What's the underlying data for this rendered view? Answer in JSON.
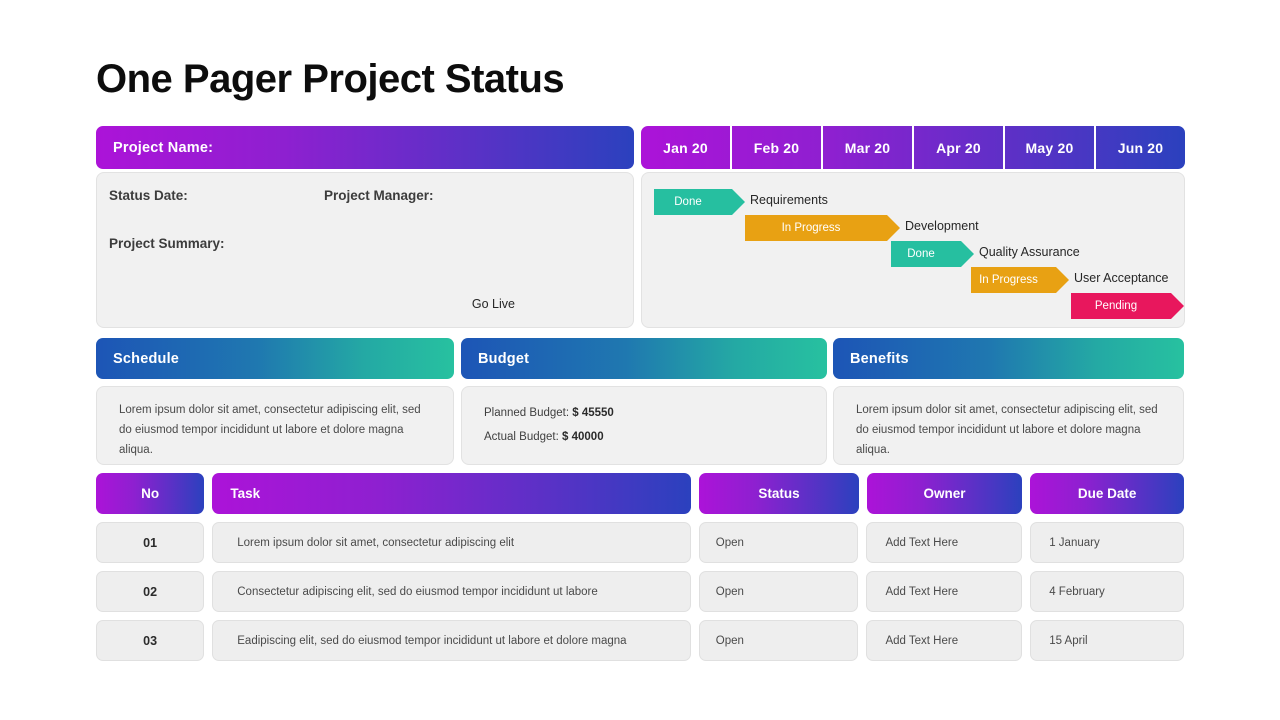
{
  "page_title": "One Pager Project Status",
  "project_name_label": "Project Name:",
  "timeline": {
    "months": [
      "Jan 20",
      "Feb 20",
      "Mar 20",
      "Apr  20",
      "May 20",
      "Jun 20"
    ]
  },
  "info": {
    "status_date_label": "Status Date:",
    "project_manager_label": "Project Manager:",
    "project_summary_label": "Project Summary:"
  },
  "gantt": {
    "colors": {
      "done": "#26bfa0",
      "in_progress": "#e8a113",
      "pending": "#e8175d"
    },
    "rows": [
      {
        "status": "Done",
        "phase": "Requirements",
        "label_side": "right"
      },
      {
        "status": "In Progress",
        "phase": "Development",
        "label_side": "right"
      },
      {
        "status": "Done",
        "phase": "Quality Assurance",
        "label_side": "right"
      },
      {
        "status": "In Progress",
        "phase": "User Acceptance",
        "label_side": "right"
      },
      {
        "status": "Pending",
        "phase": "Go Live",
        "label_side": "left"
      }
    ]
  },
  "sections": [
    {
      "title": "Schedule",
      "body": "Lorem ipsum dolor  sit amet, consectetur adipiscing elit, sed do eiusmod tempor incididunt ut labore et dolore magna aliqua."
    },
    {
      "title": "Budget",
      "planned_label": "Planned Budget:",
      "planned_value": "$ 45550",
      "actual_label": "Actual Budget:",
      "actual_value": "$ 40000"
    },
    {
      "title": "Benefits",
      "body": "Lorem ipsum dolor sit amet, consectetur adipiscing elit, sed do eiusmod tempor incididunt ut labore et dolore magna aliqua."
    }
  ],
  "table": {
    "headers": [
      "No",
      "Task",
      "Status",
      "Owner",
      "Due Date"
    ],
    "rows": [
      {
        "no": "01",
        "task": "Lorem ipsum dolor  sit amet, consectetur adipiscing elit",
        "status": "Open",
        "owner": "Add Text Here",
        "due": "1 January"
      },
      {
        "no": "02",
        "task": "Consectetur adipiscing elit, sed do eiusmod tempor incididunt ut labore",
        "status": "Open",
        "owner": "Add Text Here",
        "due": "4 February"
      },
      {
        "no": "03",
        "task": "Eadipiscing elit, sed do eiusmod tempor incididunt ut labore et dolore  magna",
        "status": "Open",
        "owner": "Add Text Here",
        "due": "15 April"
      }
    ]
  },
  "theme": {
    "purple_start": "#ac13d8",
    "purple_end": "#2b41be",
    "blue_start": "#1d55b6",
    "teal_end": "#27c1a0",
    "panel_bg": "#f1f1f1"
  }
}
